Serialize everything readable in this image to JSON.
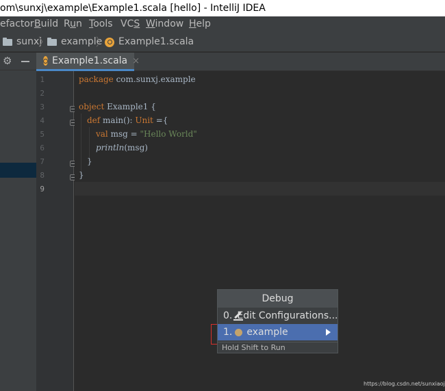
{
  "window": {
    "title": "om\\sunxj\\example\\Example1.scala [hello] - IntelliJ IDEA"
  },
  "menu": {
    "refactor_tail": "efactor",
    "build": {
      "pre": "",
      "u": "B",
      "post": "uild"
    },
    "run": {
      "pre": "R",
      "u": "u",
      "post": "n"
    },
    "tools": {
      "pre": "",
      "u": "T",
      "post": "ools"
    },
    "vcs": {
      "pre": "VC",
      "u": "S",
      "post": ""
    },
    "window": {
      "pre": "",
      "u": "W",
      "post": "indow"
    },
    "help": {
      "pre": "",
      "u": "H",
      "post": "elp"
    }
  },
  "breadcrumb": {
    "items": [
      "sunxj",
      "example",
      "Example1.scala"
    ],
    "separator": "〉"
  },
  "tab": {
    "label": "Example1.scala",
    "close": "×"
  },
  "editor": {
    "line_numbers": [
      "1",
      "2",
      "3",
      "4",
      "5",
      "6",
      "7",
      "8",
      "9"
    ],
    "line1": {
      "kw": "package",
      "rest": " com.sunxj.example"
    },
    "line3": {
      "kw": "object",
      "rest": " Example1 {"
    },
    "line4": {
      "kw": "def",
      "name": " main(): ",
      "type": "Unit",
      "rest": " ={"
    },
    "line5": {
      "kw": "val",
      "rest": " msg = ",
      "str": "\"Hello World\""
    },
    "line6": {
      "fn": "println",
      "rest": "(msg)"
    },
    "line7": {
      "text": "}"
    },
    "line8": {
      "text": "}"
    }
  },
  "popup": {
    "title": "Debug",
    "items": [
      {
        "prefix": "0.",
        "label": "Edit Configurations..."
      },
      {
        "prefix": "1.",
        "label": "example"
      }
    ],
    "footer": "Hold Shift to Run"
  },
  "watermark": "https://blog.csdn.net/sunxiaoju",
  "colors": {
    "keyword": "#cc7832",
    "string": "#6a8759",
    "selection": "#4b6eaf",
    "highlight_box": "#d9302c"
  }
}
